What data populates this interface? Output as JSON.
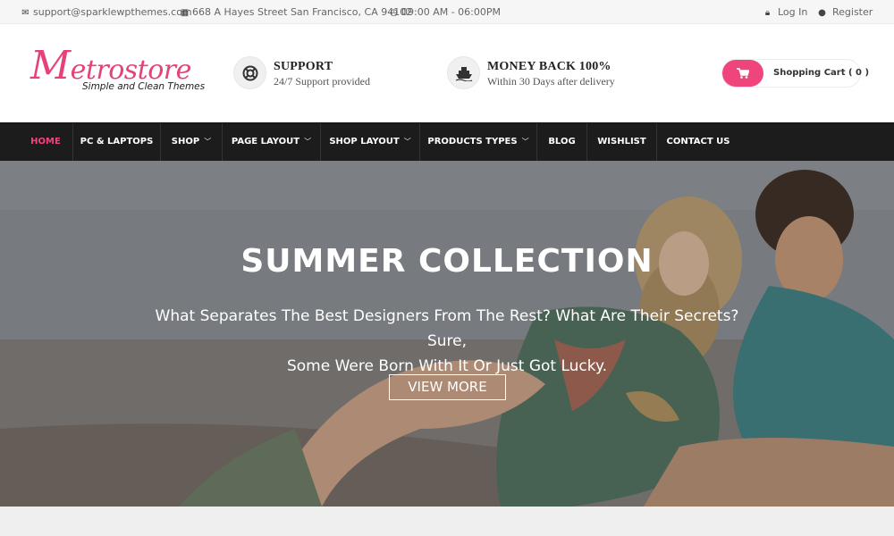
{
  "topbar": {
    "email": "support@sparklewpthemes.com",
    "address": "668 A Hayes Street San Francisco, CA 94102",
    "hours": "09:00 AM - 06:00PM",
    "login": "Log In",
    "register": "Register",
    "icons": [
      "envelope-icon",
      "map-icon",
      "clock-icon",
      "lock-icon",
      "user-icon"
    ]
  },
  "logo": {
    "first_letter": "M",
    "rest": "etrostore",
    "tagline": "Simple and Clean Themes"
  },
  "features": [
    {
      "icon": "lifebuoy-icon",
      "title": "SUPPORT",
      "subtitle": "24/7 Support provided"
    },
    {
      "icon": "ship-icon",
      "title": "MONEY BACK 100%",
      "subtitle": "Within 30 Days after delivery"
    }
  ],
  "cart": {
    "label": "Shopping Cart ( 0 )",
    "icon": "cart-icon"
  },
  "nav": {
    "items": [
      {
        "label": "HOME",
        "active": true,
        "dropdown": false
      },
      {
        "label": "PC & LAPTOPS",
        "active": false,
        "dropdown": false
      },
      {
        "label": "SHOP",
        "active": false,
        "dropdown": true
      },
      {
        "label": "PAGE LAYOUT",
        "active": false,
        "dropdown": true
      },
      {
        "label": "SHOP LAYOUT",
        "active": false,
        "dropdown": true
      },
      {
        "label": "PRODUCTS TYPES",
        "active": false,
        "dropdown": true
      },
      {
        "label": "BLOG",
        "active": false,
        "dropdown": false
      },
      {
        "label": "WISHLIST",
        "active": false,
        "dropdown": false
      },
      {
        "label": "CONTACT US",
        "active": false,
        "dropdown": false
      }
    ]
  },
  "hero": {
    "title": "SUMMER COLLECTION",
    "text_line1": "What Separates The Best Designers From The Rest? What Are Their Secrets? Sure,",
    "text_line2": "Some Were Born With It Or Just Got Lucky.",
    "button": "VIEW MORE"
  },
  "colors": {
    "accent": "#f0457c",
    "nav_bg": "#1c1c1c",
    "topbar_bg": "#f6f6f6"
  }
}
